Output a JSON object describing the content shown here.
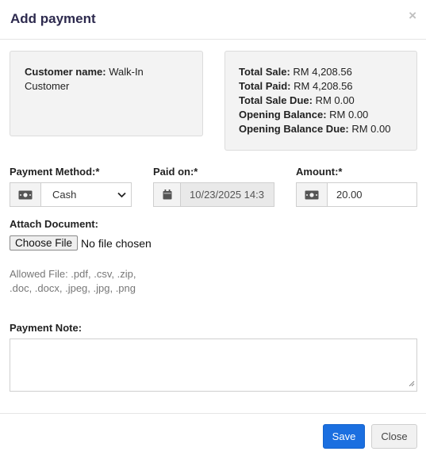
{
  "modal": {
    "title": "Add payment",
    "close_symbol": "×"
  },
  "customer": {
    "name_label": "Customer name:",
    "name_value": "Walk-In Customer"
  },
  "totals": {
    "total_sale_label": "Total Sale:",
    "total_sale_value": "RM 4,208.56",
    "total_paid_label": "Total Paid:",
    "total_paid_value": "RM 4,208.56",
    "total_sale_due_label": "Total Sale Due:",
    "total_sale_due_value": "RM 0.00",
    "opening_balance_label": "Opening Balance:",
    "opening_balance_value": "RM 0.00",
    "opening_balance_due_label": "Opening Balance Due:",
    "opening_balance_due_value": "RM 0.00"
  },
  "form": {
    "payment_method_label": "Payment Method:*",
    "payment_method_value": "Cash",
    "paid_on_label": "Paid on:*",
    "paid_on_value": "10/23/2025 14:3",
    "amount_label": "Amount:*",
    "amount_value": "20.00",
    "attach_label": "Attach Document:",
    "choose_file_label": "Choose File",
    "no_file_text": "No file chosen",
    "allowed_files_text": "Allowed File: .pdf, .csv, .zip, .doc, .docx, .jpeg, .jpg, .png",
    "note_label": "Payment Note:",
    "note_value": ""
  },
  "footer": {
    "save_label": "Save",
    "close_label": "Close"
  },
  "icons": {
    "method_addon": "money-icon",
    "paid_on_addon": "calendar-icon",
    "amount_addon": "money-icon"
  },
  "colors": {
    "title": "#2d2a4e",
    "save_button": "#1b6fe0",
    "well_background": "#f3f3f3"
  }
}
